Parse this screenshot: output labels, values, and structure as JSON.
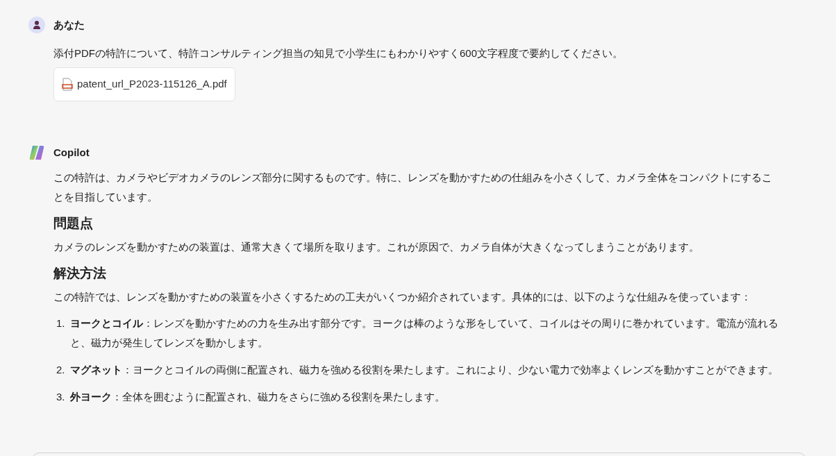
{
  "user_message": {
    "author": "あなた",
    "text": "添付PDFの特許について、特許コンサルティング担当の知見で小学生にもわかりやすく600文字程度で要約してください。",
    "attachment": {
      "filename": "patent_url_P2023-115126_A.pdf"
    }
  },
  "assistant_message": {
    "author": "Copilot",
    "blocks": [
      {
        "kind": "paragraph",
        "text": "この特許は、カメラやビデオカメラのレンズ部分に関するものです。特に、レンズを動かすための仕組みを小さくして、カメラ全体をコンパクトにすることを目指しています。"
      },
      {
        "kind": "heading",
        "text": "問題点"
      },
      {
        "kind": "paragraph",
        "text": "カメラのレンズを動かすための装置は、通常大きくて場所を取ります。これが原因で、カメラ自体が大きくなってしまうことがあります。"
      },
      {
        "kind": "heading",
        "text": "解決方法"
      },
      {
        "kind": "paragraph",
        "text": "この特許では、レンズを動かすための装置を小さくするための工夫がいくつか紹介されています。具体的には、以下のような仕組みを使っています："
      },
      {
        "kind": "list",
        "items": [
          {
            "number": "1.",
            "text": "**ヨークとコイル**：レンズを動かすための力を生み出す部分です。ヨークは棒のような形をしていて、コイルはその周りに巻かれています。電流が流れると、磁力が発生してレンズを動かします。"
          },
          {
            "number": "2.",
            "text": "**マグネット**：ヨークとコイルの両側に配置され、磁力を強める役割を果たします。これにより、少ない電力で効率よくレンズを動かすことができます。"
          },
          {
            "number": "3.",
            "text": "**外ヨーク**：全体を囲むように配置され、磁力をさらに強める役割を果たします。"
          }
        ]
      }
    ]
  }
}
